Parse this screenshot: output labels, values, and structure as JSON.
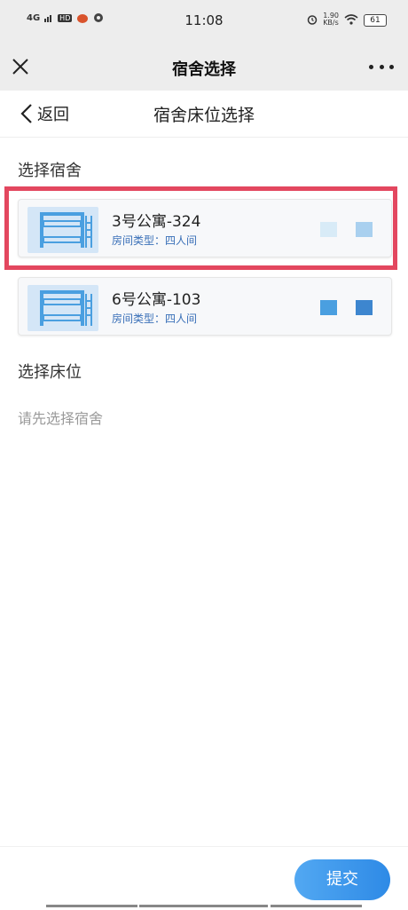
{
  "status_bar": {
    "network": "4G",
    "hd": "HD",
    "time": "11:08",
    "speed_value": "1.90",
    "speed_unit": "KB/s",
    "battery": "61"
  },
  "title_bar": {
    "title": "宿舍选择",
    "close_icon": "close-icon",
    "more_icon": "more-icon"
  },
  "page_nav": {
    "back_label": "返回",
    "title": "宿舍床位选择"
  },
  "dorm_section": {
    "label": "选择宿舍",
    "items": [
      {
        "name": "3号公寓-324",
        "type": "房间类型：四人间",
        "bed_colors": [
          "#d8ebf7",
          "#a9d0ef"
        ]
      },
      {
        "name": "6号公寓-103",
        "type": "房间类型：四人间",
        "bed_colors": [
          "#4a9fe0",
          "#3d86cf"
        ]
      }
    ]
  },
  "bed_section": {
    "label": "选择床位",
    "hint": "请先选择宿舍"
  },
  "footer": {
    "submit_label": "提交"
  },
  "colors": {
    "accent": "#2e8ae6",
    "highlight": "#e3475f",
    "type_text": "#3a70b8"
  }
}
